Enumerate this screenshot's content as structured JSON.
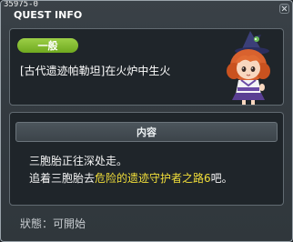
{
  "window": {
    "quest_id": "35975-0",
    "title": "QUEST INFO"
  },
  "quest": {
    "category": "一般",
    "name": "[古代遗迹帕勒坦]在火炉中生火"
  },
  "content": {
    "header": "内容",
    "line1": "三胞胎正往深处走。",
    "line2_prefix": "追着三胞胎去",
    "line2_highlight": "危险的遗迹守护者之路6",
    "line2_suffix": "吧。"
  },
  "status": {
    "text": "狀態：可開始"
  },
  "icons": {
    "close": "close-icon",
    "npc": "npc-portrait"
  },
  "colors": {
    "badge": "#8cc23a",
    "highlight": "#f2df3a"
  }
}
